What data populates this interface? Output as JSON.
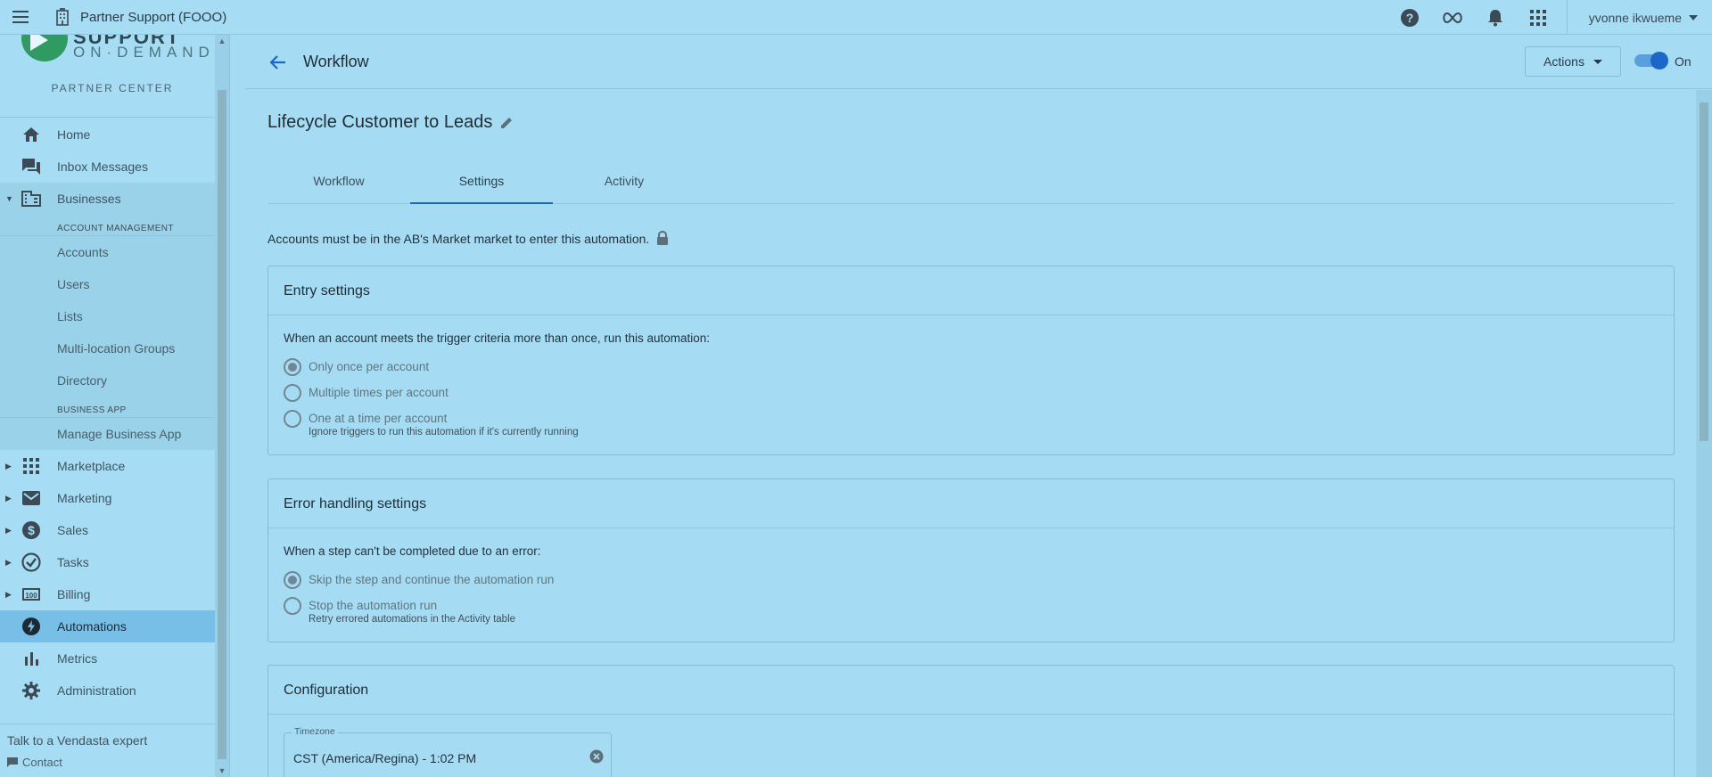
{
  "topbar": {
    "org_name": "Partner Support (FOOO)",
    "user_name": "yvonne ikwueme",
    "icons": [
      "menu-icon",
      "building-icon",
      "help-icon",
      "infinity-icon",
      "bell-icon",
      "apps-grid-icon",
      "chevron-down-icon"
    ]
  },
  "sidebar": {
    "brand_wordmark": "ON·DEMAND",
    "brand_wordmark_top": "SUPPORT",
    "partner_center": "PARTNER CENTER",
    "items": {
      "home": "Home",
      "inbox": "Inbox Messages",
      "businesses": "Businesses",
      "marketplace": "Marketplace",
      "marketing": "Marketing",
      "sales": "Sales",
      "tasks": "Tasks",
      "billing": "Billing",
      "automations": "Automations",
      "metrics": "Metrics",
      "administration": "Administration"
    },
    "account_management_header": "ACCOUNT MANAGEMENT",
    "account_management": [
      "Accounts",
      "Users",
      "Lists",
      "Multi-location Groups",
      "Directory"
    ],
    "business_app_header": "BUSINESS APP",
    "business_app": [
      "Manage Business App"
    ],
    "footer_talk": "Talk to a Vendasta expert",
    "footer_contact": "Contact"
  },
  "header": {
    "title": "Workflow",
    "actions_label": "Actions",
    "toggle_label": "On",
    "toggle_on": true
  },
  "workflow": {
    "name": "Lifecycle Customer to Leads",
    "tabs": [
      "Workflow",
      "Settings",
      "Activity"
    ],
    "active_tab": "Settings",
    "market_note": "Accounts must be in the AB's Market market to enter this automation."
  },
  "entry_settings": {
    "title": "Entry settings",
    "question": "When an account meets the trigger criteria more than once, run this automation:",
    "options": [
      "Only once per account",
      "Multiple times per account",
      "One at a time per account"
    ],
    "selected": "Only once per account",
    "hint": "Ignore triggers to run this automation if it's currently running"
  },
  "error_settings": {
    "title": "Error handling settings",
    "question": "When a step can't be completed due to an error:",
    "options": [
      "Skip the step and continue the automation run",
      "Stop the automation run"
    ],
    "selected": "Skip the step and continue the automation run",
    "hint": "Retry errored automations in the Activity table"
  },
  "configuration": {
    "title": "Configuration",
    "timezone_label": "Timezone",
    "timezone_value": "CST (America/Regina) - 1:02 PM"
  },
  "colors": {
    "background": "#a6dcf3",
    "accent": "#1a67c8",
    "active_nav": "#78bfe8",
    "brand_green": "#2f9a62"
  }
}
